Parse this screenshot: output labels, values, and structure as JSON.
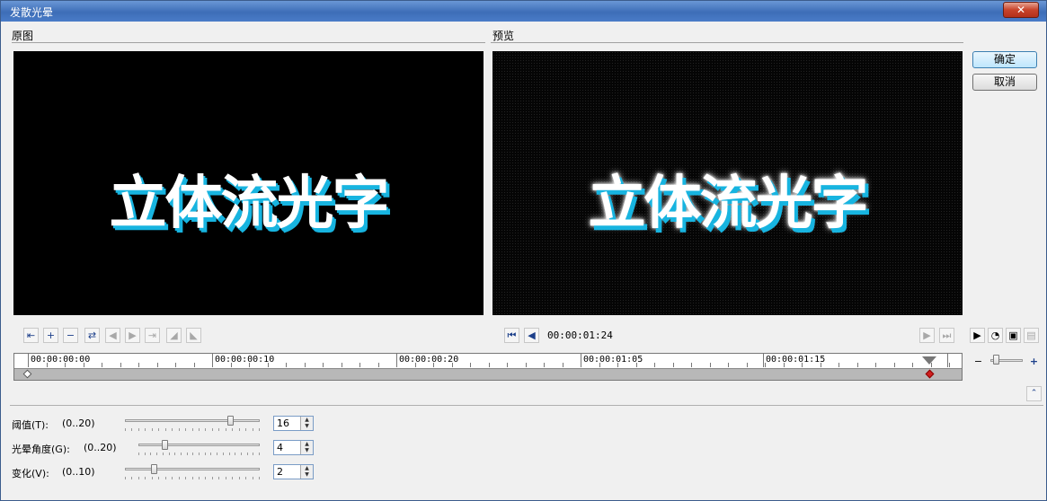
{
  "window": {
    "title": "发散光晕",
    "close_glyph": "✕"
  },
  "original": {
    "label": "原图",
    "video_text": "立体流光字"
  },
  "preview": {
    "label": "预览",
    "video_text": "立体流光字",
    "timecode": "00:00:01:24"
  },
  "buttons": {
    "ok": "确定",
    "cancel": "取消"
  },
  "timeline": {
    "labels": [
      "00:00:00:00",
      "00:00:00:10",
      "00:00:00:20",
      "00:00:01:05",
      "00:00:01:15"
    ]
  },
  "zoom": {
    "minus": "−",
    "plus": "+",
    "level": 0.1
  },
  "params": [
    {
      "label": "阈值(T):",
      "range": "(0..20)",
      "value": "16",
      "fraction": 0.8
    },
    {
      "label": "光晕角度(G):",
      "range": "(0..20)",
      "value": "4",
      "fraction": 0.2
    },
    {
      "label": "变化(V):",
      "range": "(0..10)",
      "value": "2",
      "fraction": 0.2
    }
  ],
  "icons": {
    "left_toolbar": [
      "goto-start-icon",
      "add-keyframe-icon",
      "remove-keyframe-icon",
      "reverse-keyframes-icon",
      "prev-keyframe-icon",
      "next-keyframe-icon",
      "goto-end-icon",
      "ease-in-icon",
      "ease-out-icon"
    ],
    "right_toolbar": [
      "play-icon",
      "speed-icon",
      "monitor-icon",
      "export-icon"
    ]
  },
  "colors": {
    "accent": "#17b4e0",
    "titlebar": "#3d6db7",
    "keyframe_active": "#d02020"
  }
}
